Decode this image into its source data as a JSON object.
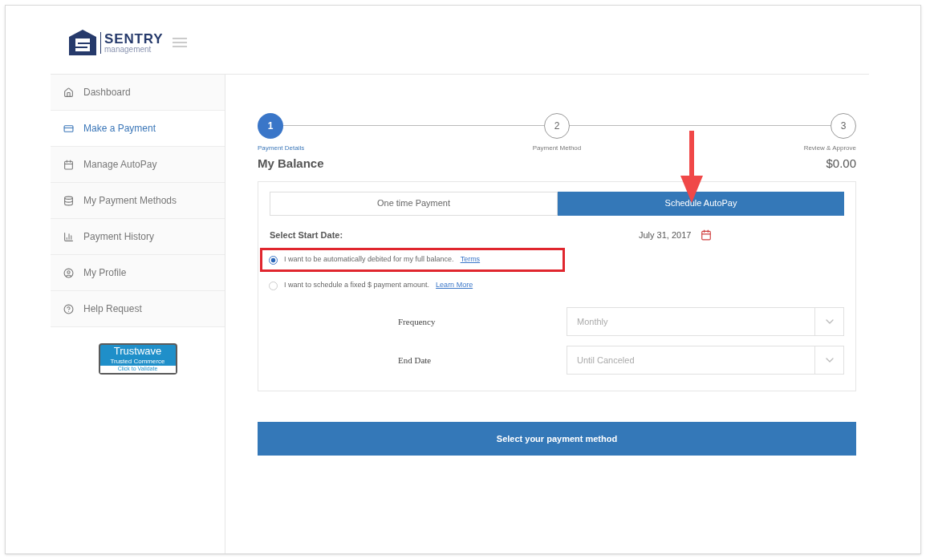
{
  "logo": {
    "name": "SENTRY",
    "subtitle": "management"
  },
  "sidebar": {
    "items": [
      {
        "label": "Dashboard",
        "selected": false
      },
      {
        "label": "Make a Payment",
        "selected": true
      },
      {
        "label": "Manage AutoPay",
        "selected": false
      },
      {
        "label": "My Payment Methods",
        "selected": false
      },
      {
        "label": "Payment History",
        "selected": false
      },
      {
        "label": "My Profile",
        "selected": false
      },
      {
        "label": "Help Request",
        "selected": false
      }
    ],
    "badge": {
      "title": "Trustwave",
      "line": "Trusted Commerce",
      "link": "Click to Validate"
    }
  },
  "steps": [
    {
      "number": "1",
      "label": "Payment Details",
      "selected": true
    },
    {
      "number": "2",
      "label": "Payment Method",
      "selected": false
    },
    {
      "number": "3",
      "label": "Review & Approve",
      "selected": false
    }
  ],
  "balance": {
    "label": "My Balance",
    "amount": "$0.00"
  },
  "tabs": [
    {
      "label": "One time Payment",
      "selected": false
    },
    {
      "label": "Schedule AutoPay",
      "selected": true
    }
  ],
  "start_date": {
    "label": "Select Start Date:",
    "value": "July 31, 2017"
  },
  "options": [
    {
      "text": "I want to be automatically debited for my full balance.",
      "link": "Terms",
      "selected": true,
      "highlighted": true
    },
    {
      "text": "I want to schedule a fixed $ payment amount.",
      "link": "Learn More",
      "selected": false,
      "highlighted": false
    }
  ],
  "fields": [
    {
      "label": "Frequency",
      "value": "Monthly"
    },
    {
      "label": "End Date",
      "value": "Until Canceled"
    }
  ],
  "submit": "Select your payment method"
}
